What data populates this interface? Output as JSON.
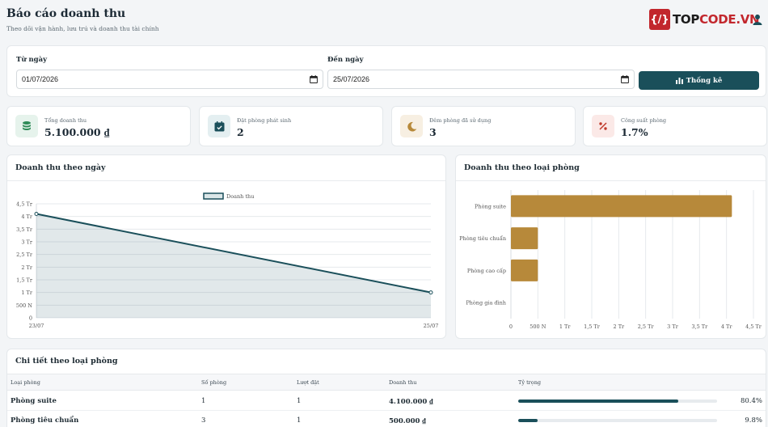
{
  "header": {
    "title": "Báo cáo doanh thu",
    "subtitle": "Theo dõi vận hành, lưu trú và doanh thu tài chính",
    "brand": {
      "mark": "{/}",
      "name_part1": "TOP",
      "name_part2": "CODE.VN"
    }
  },
  "filters": {
    "from_label": "Từ ngày",
    "from_value": "01/07/2026",
    "to_label": "Đến ngày",
    "to_value": "25/07/2026",
    "submit_label": "Thống kê"
  },
  "kpis": [
    {
      "label": "Tổng doanh thu",
      "value": "5.100.000 ₫",
      "icon": "coins-icon",
      "color": "#2e8b57",
      "bg": "#e6f3ec"
    },
    {
      "label": "Đặt phòng phát sinh",
      "value": "2",
      "icon": "calendar-check-icon",
      "color": "#1a4f5a",
      "bg": "#e4eff1"
    },
    {
      "label": "Đêm phòng đã sử dụng",
      "value": "3",
      "icon": "moon-icon",
      "color": "#b7893a",
      "bg": "#f7efe2"
    },
    {
      "label": "Công suất phòng",
      "value": "1.7%",
      "icon": "percent-icon",
      "color": "#c0392b",
      "bg": "#fbe9e7"
    }
  ],
  "line_panel": {
    "title": "Doanh thu theo ngày",
    "chart_data": {
      "type": "area",
      "categories": [
        "23/07",
        "25/07"
      ],
      "series": [
        {
          "name": "Doanh thu",
          "values": [
            4100000,
            1000000
          ]
        }
      ],
      "ylim": [
        0,
        4500000
      ],
      "yticks": [
        "0",
        "500 N",
        "1 Tr",
        "1,5 Tr",
        "2 Tr",
        "2,5 Tr",
        "3 Tr",
        "3,5 Tr",
        "4 Tr",
        "4,5 Tr"
      ],
      "legend": "top-center",
      "grid": true,
      "color": "#1a4f5a"
    }
  },
  "bar_panel": {
    "title": "Doanh thu theo loại phòng",
    "chart_data": {
      "type": "bar",
      "orientation": "horizontal",
      "categories": [
        "Phòng suite",
        "Phòng tiêu chuẩn",
        "Phòng cao cấp",
        "Phòng gia đình"
      ],
      "values": [
        4100000,
        500000,
        500000,
        0
      ],
      "xlim": [
        0,
        4500000
      ],
      "xticks": [
        "0",
        "500 N",
        "1 Tr",
        "1,5 Tr",
        "2 Tr",
        "2,5 Tr",
        "3 Tr",
        "3,5 Tr",
        "4 Tr",
        "4,5 Tr"
      ],
      "grid": true,
      "color": "#b7893a"
    }
  },
  "table": {
    "title": "Chi tiết theo loại phòng",
    "columns": [
      "Loại phòng",
      "Số phòng",
      "Lượt đặt",
      "Doanh thu",
      "Tỷ trọng"
    ],
    "rows": [
      {
        "type": "Phòng suite",
        "rooms": "1",
        "bookings": "1",
        "revenue": "4.100.000 ₫",
        "share": 80.4,
        "share_label": "80.4%"
      },
      {
        "type": "Phòng tiêu chuẩn",
        "rooms": "3",
        "bookings": "1",
        "revenue": "500.000 ₫",
        "share": 9.8,
        "share_label": "9.8%"
      }
    ]
  }
}
